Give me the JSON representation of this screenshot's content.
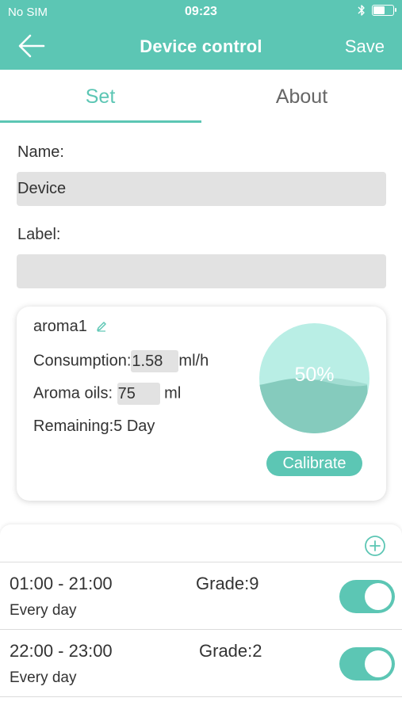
{
  "status_bar": {
    "carrier": "No SIM",
    "time": "09:23",
    "bluetooth_icon": "bluetooth-icon",
    "battery_icon": "battery-charging-icon"
  },
  "nav": {
    "back_icon": "arrow-left-icon",
    "title": "Device control",
    "save_label": "Save"
  },
  "tabs": [
    {
      "label": "Set",
      "active": true
    },
    {
      "label": "About",
      "active": false
    }
  ],
  "form": {
    "name_label": "Name:",
    "name_value": "Device",
    "label_label": "Label:",
    "label_value": ""
  },
  "aroma": {
    "name": "aroma1",
    "edit_icon": "pencil-icon",
    "consumption_label": "Consumption:",
    "consumption_value": "1.58",
    "consumption_unit": "ml/h",
    "oils_label": "Aroma oils:",
    "oils_value": "75",
    "oils_unit": "ml",
    "remaining_label": "Remaining:",
    "remaining_value": "5 Day",
    "level_percent": "50%",
    "level_fraction": 0.5,
    "calibrate_label": "Calibrate"
  },
  "schedule": {
    "add_icon": "add-circle-icon",
    "items": [
      {
        "time": "01:00 - 21:00",
        "grade": "Grade:9",
        "repeat": "Every day",
        "enabled": true
      },
      {
        "time": "22:00 - 23:00",
        "grade": "Grade:2",
        "repeat": "Every day",
        "enabled": true
      }
    ]
  },
  "colors": {
    "accent": "#5cc6b4",
    "gauge_light": "#b9eee5",
    "gauge_dark": "#85cbbd",
    "input_bg": "#e2e2e2"
  }
}
